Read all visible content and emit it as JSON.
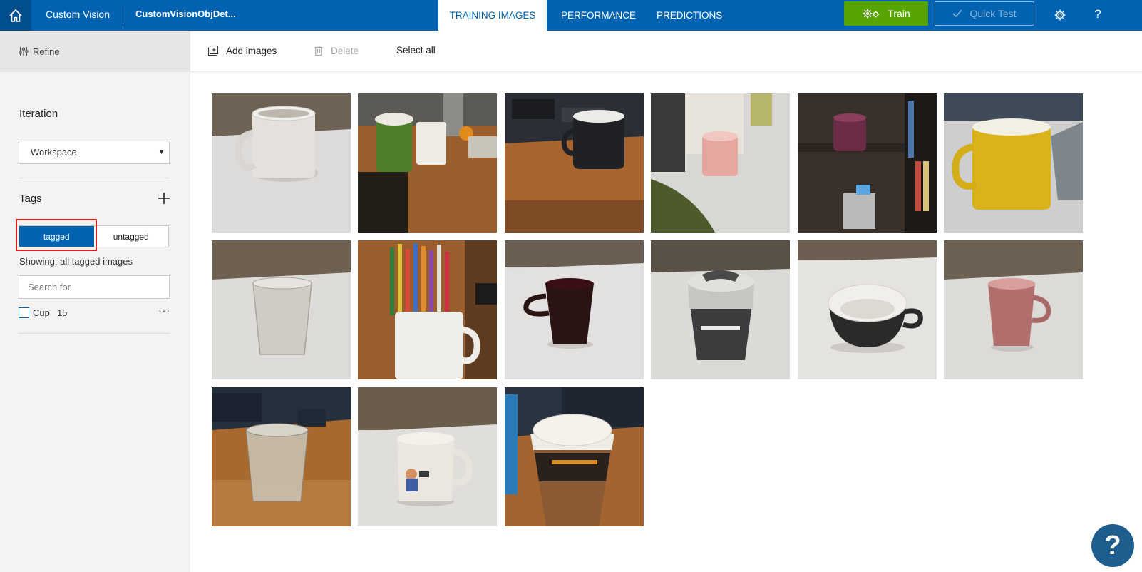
{
  "header": {
    "brand": "Custom Vision",
    "project": "CustomVisionObjDet...",
    "tabs": [
      {
        "label": "TRAINING IMAGES",
        "active": true
      },
      {
        "label": "PERFORMANCE",
        "active": false
      },
      {
        "label": "PREDICTIONS",
        "active": false
      }
    ],
    "train_label": "Train",
    "quick_test_label": "Quick Test",
    "help_label": "?"
  },
  "sidebar": {
    "refine_label": "Refine",
    "iteration_title": "Iteration",
    "iteration_value": "Workspace",
    "tags_title": "Tags",
    "toggle": {
      "tagged": "tagged",
      "untagged": "untagged",
      "selected": "tagged"
    },
    "showing_text": "Showing: all tagged images",
    "search_placeholder": "Search for",
    "tags": [
      {
        "name": "Cup",
        "count": "15"
      }
    ]
  },
  "toolbar": {
    "add_images": "Add images",
    "delete": "Delete",
    "select_all": "Select all"
  },
  "images": [
    {
      "subject": "white mug on table"
    },
    {
      "subject": "coffee cups on wooden desk"
    },
    {
      "subject": "black Microsoft mug on desk"
    },
    {
      "subject": "pink mug near monitor"
    },
    {
      "subject": "purple mug on shelf"
    },
    {
      "subject": "yellow mug near laptop"
    },
    {
      "subject": "glass cup on table"
    },
    {
      "subject": "mug holding pencils"
    },
    {
      "subject": "dark red mug"
    },
    {
      "subject": "reusable cup with lid"
    },
    {
      "subject": "Microsoft teacup"
    },
    {
      "subject": "pink mug on table"
    },
    {
      "subject": "glass on wooden desk"
    },
    {
      "subject": "mug with cartoon"
    },
    {
      "subject": "takeaway coffee cup"
    }
  ],
  "colors": {
    "accent": "#0063b1",
    "home_bg": "#004e8c",
    "train": "#57a300",
    "highlight": "#e02020",
    "help_fab": "#1d5e8f"
  },
  "icons": {
    "home": "home-icon",
    "train": "gears-icon",
    "quick_test": "check-icon",
    "settings": "gear-icon",
    "refine": "sliders-icon",
    "add_tag": "plus-icon",
    "add_images": "add-image-icon",
    "delete": "trash-icon"
  }
}
